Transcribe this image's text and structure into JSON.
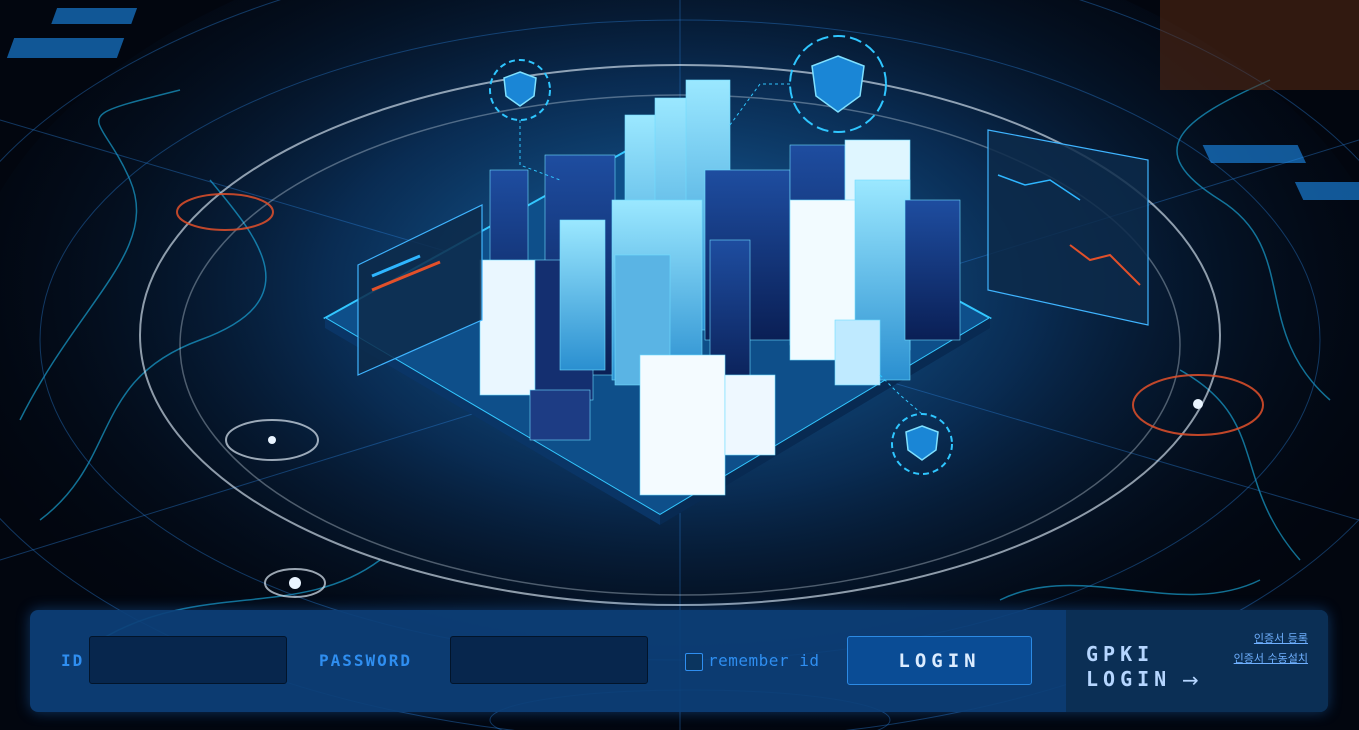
{
  "login_form": {
    "id_label": "ID",
    "id_value": "",
    "password_label": "PASSWORD",
    "password_value": "",
    "remember_label": "remember id",
    "remember_checked": false,
    "login_button": "LOGIN"
  },
  "gpki": {
    "title_line1": "GPKI",
    "title_line2": "LOGIN",
    "arrow": "→",
    "cert_register": "인증서 등록",
    "cert_manual_install": "인증서 수동설치"
  },
  "theme": {
    "accent": "#2f8ef0",
    "panel": "#0d407a",
    "gpki_panel": "#0b2f55",
    "highlight_orange": "#e2502a",
    "cyan": "#28d4ff"
  }
}
